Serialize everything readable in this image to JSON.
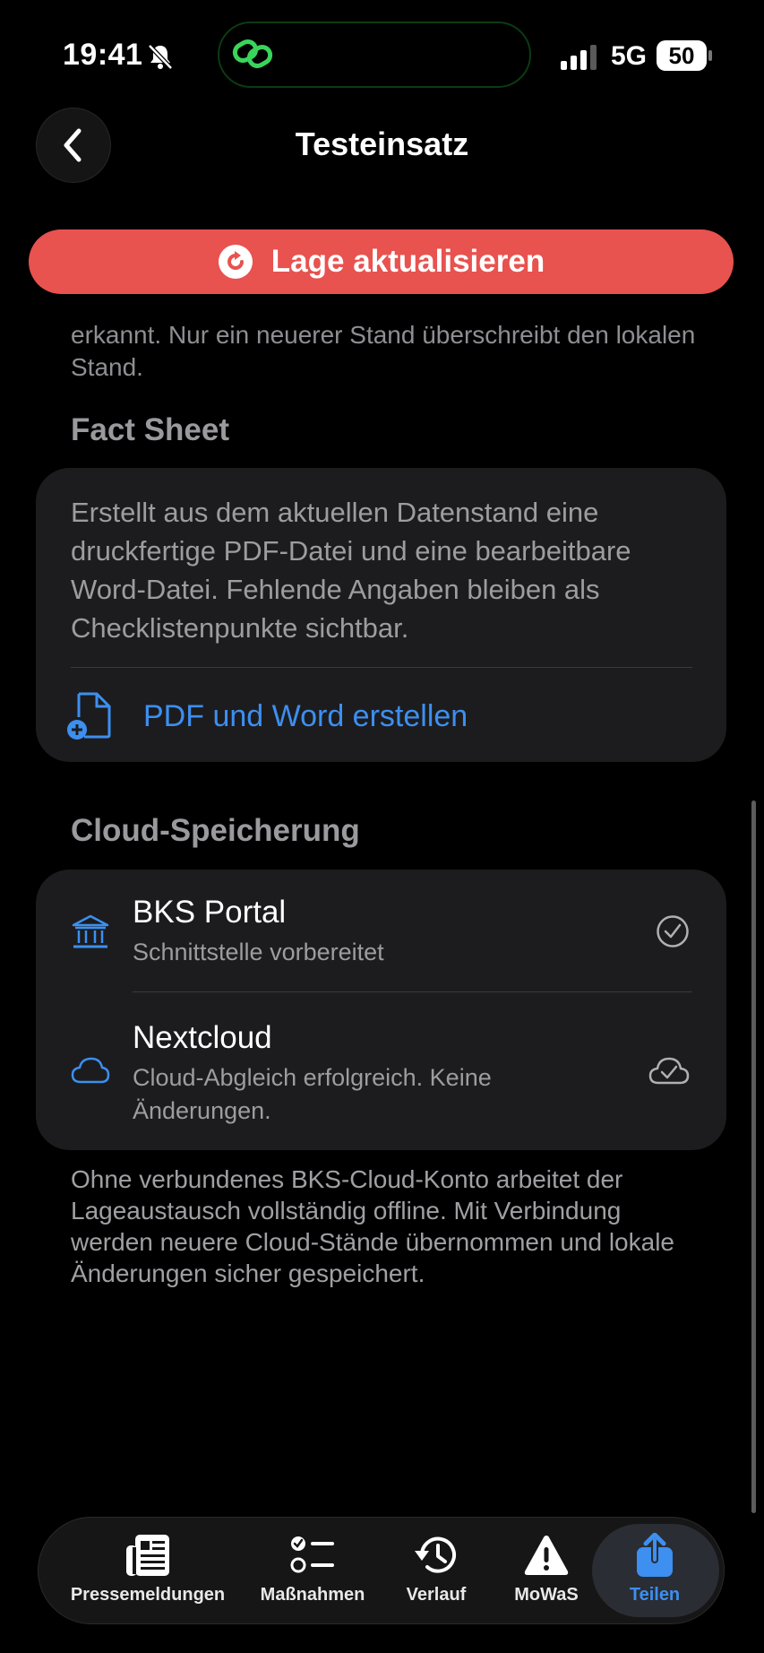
{
  "status_bar": {
    "time": "19:41",
    "network": "5G",
    "battery": "50"
  },
  "nav": {
    "title": "Testeinsatz"
  },
  "update_button": {
    "label": "Lage aktualisieren"
  },
  "intro_text": "erkannt. Nur ein neuerer Stand überschreibt den lokalen Stand.",
  "fact_sheet": {
    "title": "Fact Sheet",
    "description": "Erstellt aus dem aktuellen Datenstand eine druckfertige PDF-Datei und eine bearbeitbare Word-Datei. Fehlende Angaben bleiben als Checklistenpunkte sichtbar.",
    "action_label": "PDF und Word erstellen"
  },
  "cloud": {
    "title": "Cloud-Speicherung",
    "items": [
      {
        "title": "BKS Portal",
        "subtitle": "Schnittstelle vorbereitet"
      },
      {
        "title": "Nextcloud",
        "subtitle": "Cloud-Abgleich erfolgreich. Keine Änderungen."
      }
    ],
    "footer": "Ohne verbundenes BKS-Cloud-Konto arbeitet der Lageaustausch vollständig offline. Mit Verbindung werden neuere Cloud-Stände übernommen und lokale Änderungen sicher gespeichert."
  },
  "tabs": [
    {
      "label": "Pressemeldungen",
      "icon": "newspaper-icon"
    },
    {
      "label": "Maßnahmen",
      "icon": "checklist-icon"
    },
    {
      "label": "Verlauf",
      "icon": "history-icon"
    },
    {
      "label": "MoWaS",
      "icon": "warning-icon"
    },
    {
      "label": "Teilen",
      "icon": "share-icon",
      "active": true
    }
  ],
  "colors": {
    "accent_blue": "#3d8ff0",
    "update_red": "#e8524f",
    "background": "#000000",
    "card": "#1c1c1e"
  }
}
